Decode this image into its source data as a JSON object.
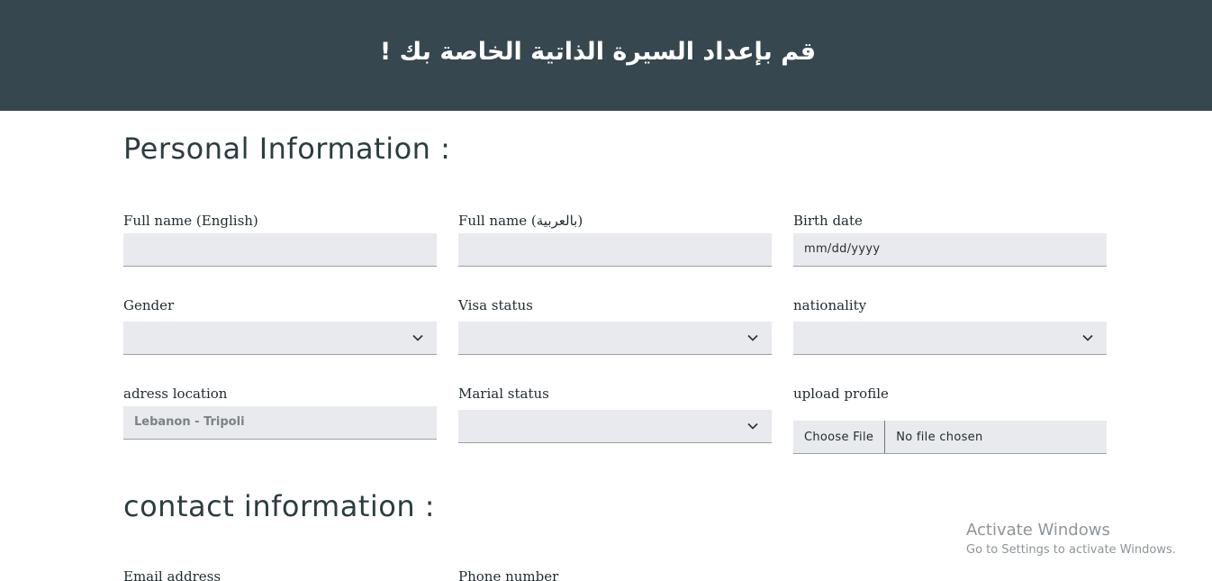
{
  "header": {
    "title": "قم بإعداد السيرة الذاتية الخاصة بك !"
  },
  "personal": {
    "title": "Personal Information :",
    "fields": {
      "full_name_en": {
        "label": "Full name (English)",
        "value": ""
      },
      "full_name_ar": {
        "label": "Full name (بالعربية)",
        "value": ""
      },
      "birth_date": {
        "label": "Birth date",
        "display": "mm/dd/yyyy"
      },
      "gender": {
        "label": "Gender",
        "selected": ""
      },
      "visa_status": {
        "label": "Visa status",
        "selected": ""
      },
      "nationality": {
        "label": "nationality",
        "selected": ""
      },
      "address": {
        "label": "adress location",
        "placeholder": "Lebanon - Tripoli"
      },
      "marital_status": {
        "label": "Marial status",
        "selected": ""
      },
      "upload": {
        "label": "upload profile",
        "button": "Choose File",
        "status": "No file chosen"
      }
    }
  },
  "contact": {
    "title": "contact information :",
    "fields": {
      "email": {
        "label": "Email address"
      },
      "phone": {
        "label": "Phone number"
      }
    }
  },
  "watermark": {
    "title": "Activate Windows",
    "subtitle": "Go to Settings to activate Windows."
  },
  "colors": {
    "header_bg": "#37474f",
    "field_bg": "#e8eaed",
    "section_title": "#2b3d40"
  },
  "icons": {
    "select_arrow": "chevron-down-icon"
  }
}
